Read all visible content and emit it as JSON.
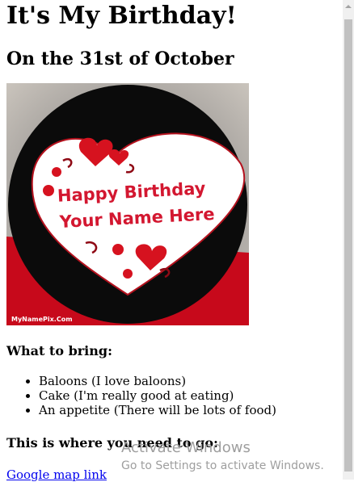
{
  "page": {
    "title": "It's My Birthday!",
    "subtitle": "On the 31st of October",
    "image": {
      "line1": "Happy Birthday",
      "line2": "Your Name Here",
      "credit": "MyNamePix.Com"
    },
    "bring_heading": "What to bring:",
    "bring_items": [
      "Baloons (I love baloons)",
      "Cake (I'm really good at eating)",
      "An appetite (There will be lots of food)"
    ],
    "go_heading": "This is where you need to go:",
    "map_link": "Google map link"
  },
  "watermark": {
    "line1": "Activate Windows",
    "line2": "Go to Settings to activate Windows."
  }
}
